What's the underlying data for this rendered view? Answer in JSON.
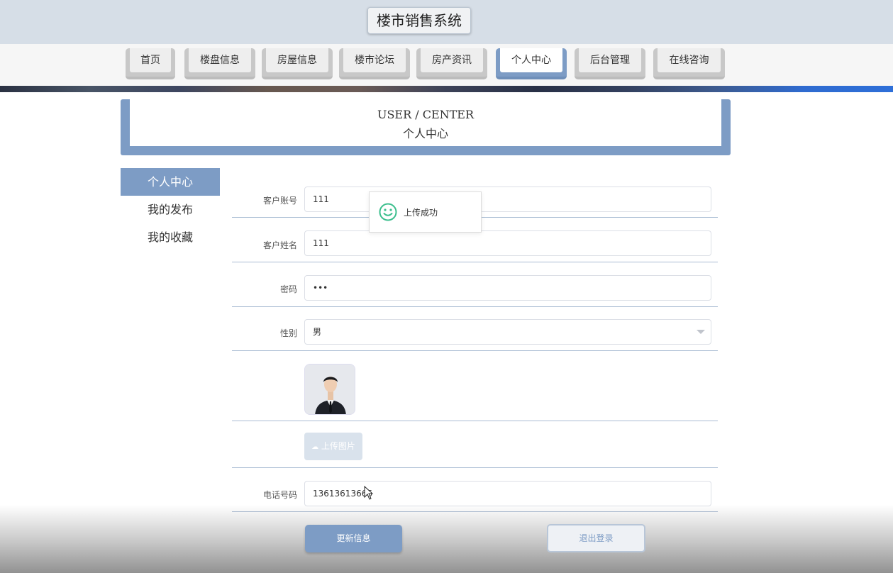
{
  "header": {
    "title": "楼市销售系统"
  },
  "nav": {
    "items": [
      {
        "label": "首页"
      },
      {
        "label": "楼盘信息"
      },
      {
        "label": "房屋信息"
      },
      {
        "label": "楼市论坛"
      },
      {
        "label": "房产资讯"
      },
      {
        "label": "个人中心",
        "active": true
      },
      {
        "label": "后台管理"
      },
      {
        "label": "在线咨询"
      }
    ]
  },
  "section": {
    "title_en": "USER / CENTER",
    "title_cn": "个人中心"
  },
  "sidebar": {
    "items": [
      {
        "label": "个人中心",
        "active": true
      },
      {
        "label": "我的发布"
      },
      {
        "label": "我的收藏"
      }
    ]
  },
  "form": {
    "account_label": "客户账号",
    "account_value": "111",
    "name_label": "客户姓名",
    "name_value": "111",
    "password_label": "密码",
    "password_value": "•••",
    "gender_label": "性别",
    "gender_value": "男",
    "upload_button": "上传图片",
    "phone_label": "电话号码",
    "phone_value": "13613613666"
  },
  "toast": {
    "message": "上传成功",
    "icon": "smile-icon"
  },
  "actions": {
    "update_label": "更新信息",
    "logout_label": "退出登录"
  },
  "colors": {
    "accent": "#7d9cc5",
    "header_bg": "#d6dee7",
    "toast_icon": "#3dbf8e"
  }
}
